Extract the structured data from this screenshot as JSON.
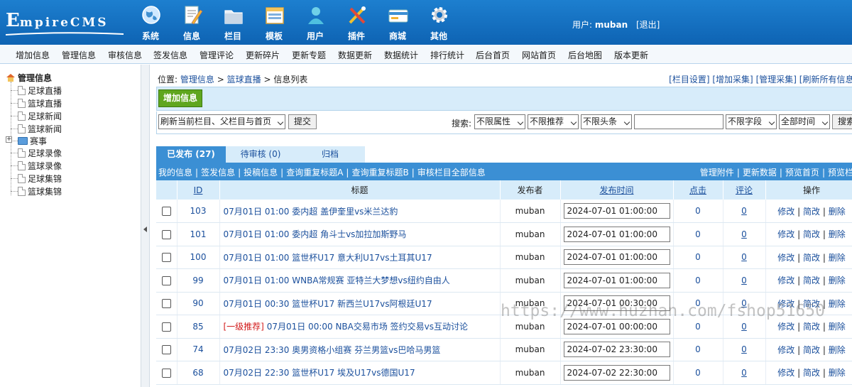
{
  "brand": {
    "logo_text": "EmpireCMS",
    "logo_initial": "E",
    "logo_rest": "mpireCMS"
  },
  "topnav": [
    {
      "label": "系统",
      "icon": "globe-icon"
    },
    {
      "label": "信息",
      "icon": "edit-document-icon"
    },
    {
      "label": "栏目",
      "icon": "folder-icon"
    },
    {
      "label": "模板",
      "icon": "window-template-icon"
    },
    {
      "label": "用户",
      "icon": "user-icon"
    },
    {
      "label": "插件",
      "icon": "tools-icon"
    },
    {
      "label": "商城",
      "icon": "card-icon"
    },
    {
      "label": "其他",
      "icon": "gear-icon"
    }
  ],
  "user": {
    "prefix": "用户:",
    "name": "muban",
    "logout": "[退出]"
  },
  "menubar": [
    "增加信息",
    "管理信息",
    "审核信息",
    "签发信息",
    "管理评论",
    "更新碎片",
    "更新专题",
    "数据更新",
    "数据统计",
    "排行统计",
    "后台首页",
    "网站首页",
    "后台地图",
    "版本更新"
  ],
  "tree": {
    "root": "管理信息",
    "items_top": [
      "足球直播",
      "篮球直播",
      "足球新闻",
      "篮球新闻"
    ],
    "folder": "赛事",
    "items_bottom": [
      "足球录像",
      "篮球录像",
      "足球集锦",
      "篮球集锦"
    ]
  },
  "crumb": {
    "prefix": "位置:",
    "l1": "管理信息",
    "sep": ">",
    "l2": "篮球直播",
    "l3": "> 信息列表"
  },
  "crumb_right": {
    "a": "[栏目设置]",
    "b": "[增加采集]",
    "c": "[管理采集]",
    "d": "[刷新所有信息J"
  },
  "toolbar": {
    "add_label": "增加信息"
  },
  "filter": {
    "refresh_select": "刷新当前栏目、父栏目与首页",
    "submit": "提交",
    "search_label": "搜索:",
    "attr_select": "不限属性",
    "rec_select": "不限推荐",
    "head_select": "不限头条",
    "search_value": "",
    "field_select": "不限字段",
    "time_select": "全部时间",
    "search_button": "搜索"
  },
  "tabs": [
    {
      "label": "已发布 (27)",
      "active": true
    },
    {
      "label": "待审核 (0)",
      "active": false
    },
    {
      "label": "归档",
      "active": false
    }
  ],
  "subbar": {
    "left": [
      "我的信息",
      "签发信息",
      "投稿信息",
      "查询重复标题A",
      "查询重复标题B",
      "审核栏目全部信息"
    ],
    "right": [
      "管理附件",
      "更新数据",
      "预览首页",
      "预览栏"
    ]
  },
  "table": {
    "headers": {
      "id": "ID",
      "title": "标题",
      "publisher": "发布者",
      "time": "发布时间",
      "clicks": "点击",
      "comments": "评论",
      "ops": "操作"
    },
    "ops": {
      "edit": "修改",
      "quick_edit": "简改",
      "delete": "删除",
      "sep": "|"
    },
    "rows": [
      {
        "id": "103",
        "tag": "",
        "title": "07月01日 01:00 委内超 盖伊奎里vs米兰达豹",
        "publisher": "muban",
        "time": "2024-07-01 01:00:00",
        "clicks": "0",
        "comments": "0"
      },
      {
        "id": "101",
        "tag": "",
        "title": "07月01日 01:00 委内超 角斗士vs加拉加斯野马",
        "publisher": "muban",
        "time": "2024-07-01 01:00:00",
        "clicks": "0",
        "comments": "0"
      },
      {
        "id": "100",
        "tag": "",
        "title": "07月01日 01:00 篮世杯U17 意大利U17vs土耳其U17",
        "publisher": "muban",
        "time": "2024-07-01 01:00:00",
        "clicks": "0",
        "comments": "0"
      },
      {
        "id": "99",
        "tag": "",
        "title": "07月01日 01:00 WNBA常规赛 亚特兰大梦想vs纽约自由人",
        "publisher": "muban",
        "time": "2024-07-01 01:00:00",
        "clicks": "0",
        "comments": "0"
      },
      {
        "id": "90",
        "tag": "",
        "title": "07月01日 00:30 篮世杯U17 新西兰U17vs阿根廷U17",
        "publisher": "muban",
        "time": "2024-07-01 00:30:00",
        "clicks": "0",
        "comments": "0"
      },
      {
        "id": "85",
        "tag": "[一级推荐]",
        "title": "07月01日 00:00 NBA交易市场 签约交易vs互动讨论",
        "publisher": "muban",
        "time": "2024-07-01 00:00:00",
        "clicks": "0",
        "comments": "0"
      },
      {
        "id": "74",
        "tag": "",
        "title": "07月02日 23:30 奥男资格小组赛 芬兰男篮vs巴哈马男篮",
        "publisher": "muban",
        "time": "2024-07-02 23:30:00",
        "clicks": "0",
        "comments": "0"
      },
      {
        "id": "68",
        "tag": "",
        "title": "07月02日 22:30 篮世杯U17 埃及U17vs德国U17",
        "publisher": "muban",
        "time": "2024-07-02 22:30:00",
        "clicks": "0",
        "comments": "0"
      }
    ]
  },
  "watermark": "https://www.huzhan.com/fshop51650",
  "colors": {
    "banner": "#1470c2",
    "accent": "#3b8fd4",
    "light": "#d7ecfa",
    "link": "#1a4f9c",
    "tag_red": "#d21a1a",
    "add_green": "#5fa61e"
  }
}
